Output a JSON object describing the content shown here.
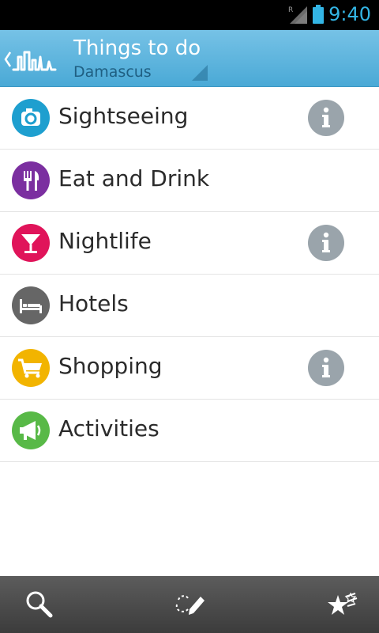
{
  "status_bar": {
    "clock": "9:40",
    "roaming_indicator": "R",
    "icons": [
      "signal-icon",
      "battery-icon"
    ],
    "accent_color": "#33b5e5"
  },
  "action_bar": {
    "title": "Things to do",
    "subtitle": "Damascus",
    "icons": [
      "back-chevron-icon",
      "city-skyline-logo-icon",
      "spinner-triangle-icon"
    ]
  },
  "categories": [
    {
      "label": "Sightseeing",
      "icon": "camera-icon",
      "color": "#1e9fcf",
      "has_info": true
    },
    {
      "label": "Eat and Drink",
      "icon": "fork-knife-icon",
      "color": "#7b2fa0",
      "has_info": false
    },
    {
      "label": "Nightlife",
      "icon": "cocktail-glass-icon",
      "color": "#e0145a",
      "has_info": true
    },
    {
      "label": "Hotels",
      "icon": "bed-icon",
      "color": "#666666",
      "has_info": false
    },
    {
      "label": "Shopping",
      "icon": "shopping-cart-icon",
      "color": "#f2b400",
      "has_info": true
    },
    {
      "label": "Activities",
      "icon": "megaphone-icon",
      "color": "#58b947",
      "has_info": false
    }
  ],
  "bottom_bar": {
    "buttons": [
      "search-icon",
      "draw-route-icon",
      "favorites-stars-icon"
    ]
  }
}
